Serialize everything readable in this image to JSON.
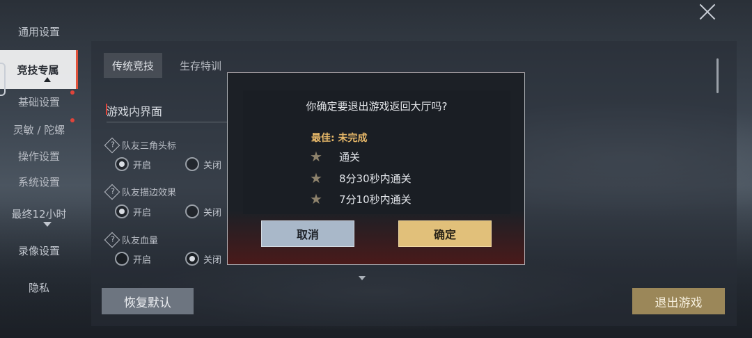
{
  "sidebar": {
    "items": [
      {
        "label": "通用设置"
      },
      {
        "label": "竞技专属"
      },
      {
        "label": "基础设置"
      },
      {
        "label": "灵敏 / 陀螺"
      },
      {
        "label": "操作设置"
      },
      {
        "label": "系统设置"
      },
      {
        "label": "最终12小时"
      },
      {
        "label": "录像设置"
      },
      {
        "label": "隐私"
      }
    ]
  },
  "tabs": [
    {
      "label": "传统竞技",
      "active": true
    },
    {
      "label": "生存特训",
      "active": false
    }
  ],
  "section": {
    "title": "游戏内界面",
    "options": [
      {
        "label": "队友三角头标",
        "on_label": "开启",
        "off_label": "关闭",
        "selected": "on"
      },
      {
        "label": "队友描边效果",
        "on_label": "开启",
        "off_label": "关闭",
        "selected": "on"
      },
      {
        "label": "队友血量",
        "on_label": "开启",
        "off_label": "关闭",
        "selected": "off"
      }
    ],
    "help_glyph": "?"
  },
  "buttons": {
    "restore": "恢复默认",
    "exit_game": "退出游戏"
  },
  "dialog": {
    "title": "你确定要退出游戏返回大厅吗?",
    "best_label": "最佳:",
    "best_value": "未完成",
    "goals": [
      "通关",
      "8分30秒内通关",
      "7分10秒内通关"
    ],
    "cancel": "取消",
    "confirm": "确定"
  },
  "colors": {
    "accent_red": "#e0443a",
    "gold": "#e7b869",
    "confirm_button": "#e1c07a",
    "cancel_button": "#a9b8c9"
  },
  "icons": {
    "close": "close-icon",
    "star": "star-icon",
    "help": "help-icon"
  }
}
